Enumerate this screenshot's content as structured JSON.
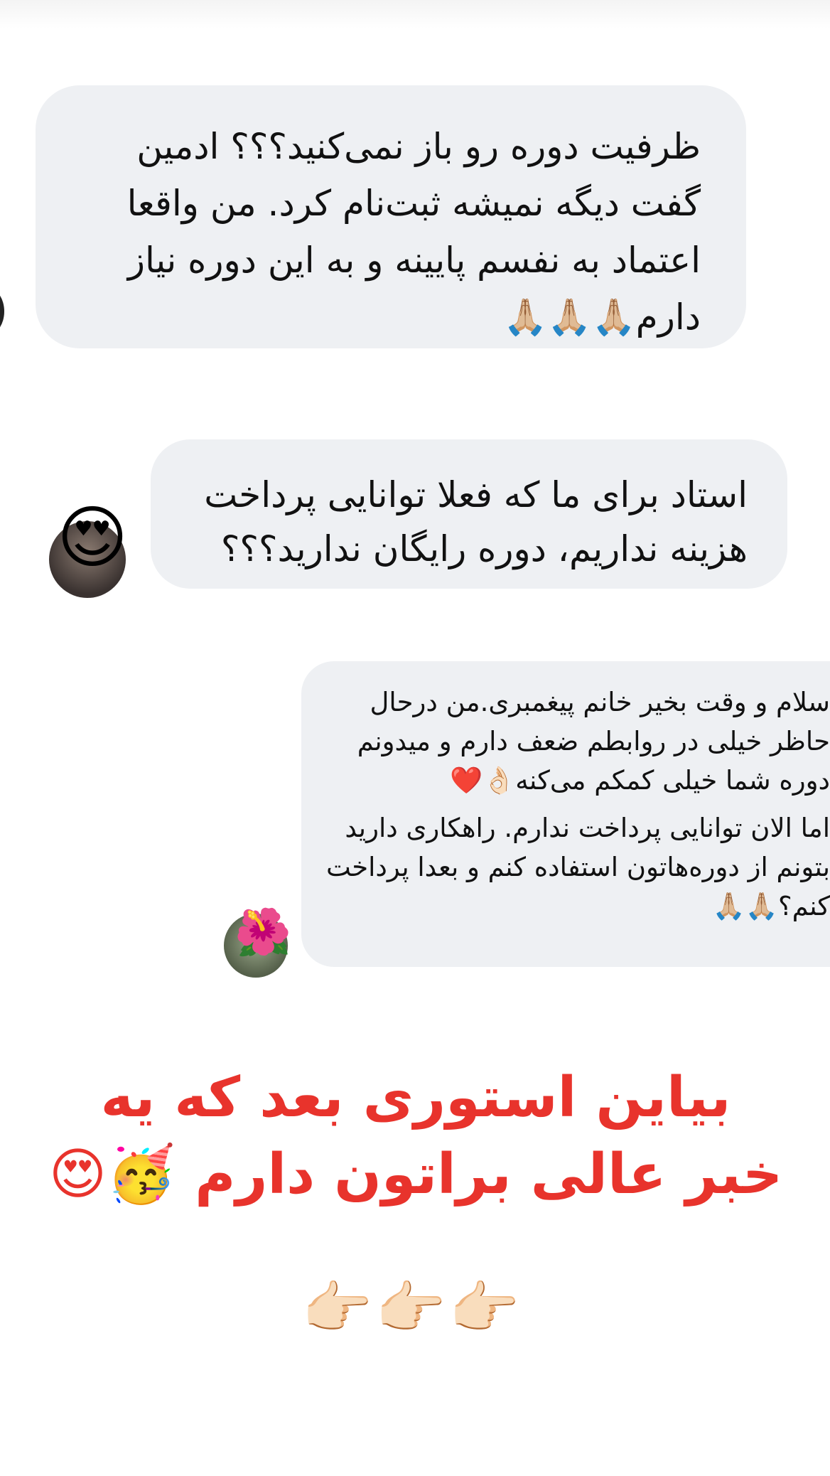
{
  "messages": [
    {
      "lines": [
        "ظرفیت دوره رو باز نمی‌کنید؟؟؟ ادمین",
        "گفت دیگه نمیشه ثبت‌نام کرد. من واقعا",
        "اعتماد به نفسم پایینه و به این دوره نیاز",
        "دارم🙏🏼🙏🏼🙏🏼"
      ]
    },
    {
      "lines": [
        "استاد برای ما که فعلا توانایی پرداخت",
        "هزینه نداریم، دوره رایگان ندارید؟؟؟"
      ],
      "reaction": "😍"
    },
    {
      "paragraphs": [
        "سلام و وقت بخیر خانم پیغمبری.من درحال حاظر خیلی در روابطم ضعف دارم و میدونم دوره شما خیلی کمکم می‌کنه👌🏻❤️",
        "اما الان توانایی پرداخت ندارم. راهکاری دارید بتونم از دوره‌هاتون استفاده کنم و بعدا پرداخت کنم؟🙏🏼🙏🏼"
      ],
      "avatar_emoji": "🌺"
    }
  ],
  "announcement": {
    "line1": "بیاین استوری بعد که یه",
    "line2": "خبر عالی براتون دارم 🥳😍"
  },
  "pointers": "👉🏻👉🏻👉🏻",
  "colors": {
    "bubble": "#eef0f3",
    "announcement": "#e8332c"
  }
}
